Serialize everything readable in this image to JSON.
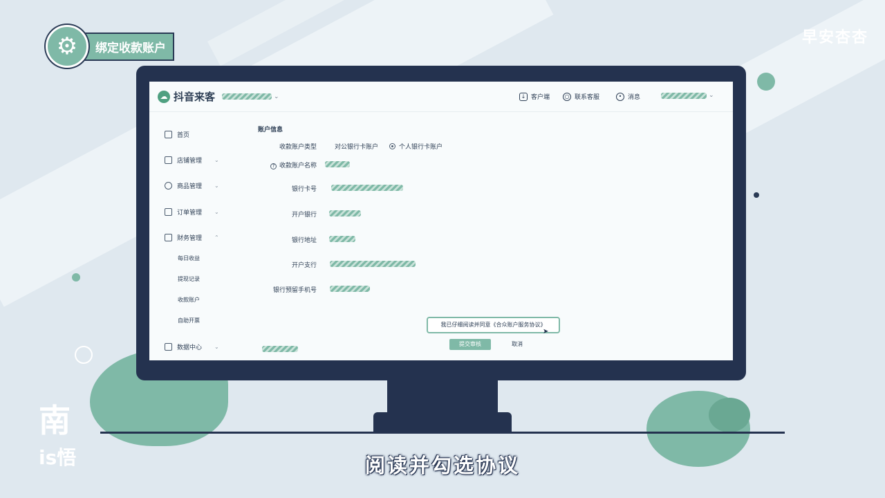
{
  "overlay": {
    "badge_label": "绑定收款账户",
    "watermark": "早安杏杏",
    "logo_top": "南",
    "logo_bottom": "is悟",
    "subtitle": "阅读并勾选协议"
  },
  "app": {
    "brand": "抖音来客",
    "header_links": [
      "客户端",
      "联系客服",
      "消息"
    ]
  },
  "sidebar": {
    "items": [
      {
        "label": "首页"
      },
      {
        "label": "店铺管理"
      },
      {
        "label": "商品管理"
      },
      {
        "label": "订单管理"
      },
      {
        "label": "财务管理"
      },
      {
        "label": "数据中心"
      }
    ],
    "finance_sub": [
      "每日收益",
      "提现记录",
      "收款账户",
      "自助开票"
    ]
  },
  "form": {
    "section_title": "账户信息",
    "account_type_label": "收款账户类型",
    "account_type_options": [
      "对公银行卡账户",
      "个人银行卡账户"
    ],
    "account_name_label": "收款账户名称",
    "card_number_label": "银行卡号",
    "bank_label": "开户银行",
    "bank_address_label": "银行地址",
    "branch_label": "开户支行",
    "phone_label": "银行预留手机号",
    "agreement_text": "我已仔细阅读并同意《合众账户服务协议》",
    "submit_label": "提交审核",
    "cancel_label": "取消"
  },
  "colors": {
    "accent": "#7fb9a7",
    "frame": "#24324f",
    "background": "#dfe8ef"
  }
}
